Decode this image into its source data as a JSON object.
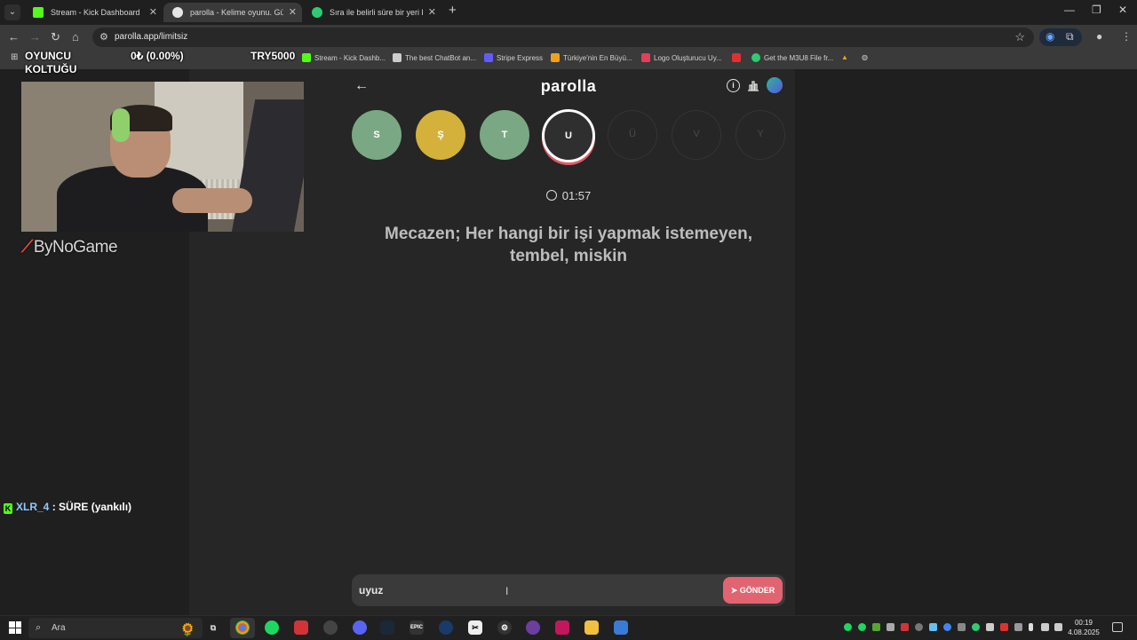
{
  "browser": {
    "tabs": [
      {
        "title": "Stream - Kick Dashboard",
        "favicon_color": "#53fc18"
      },
      {
        "title": "parolla - Kelime oyunu. Günlük",
        "favicon_color": "#e6e6e6"
      },
      {
        "title": "Sıra ile belirli süre bir yeri bekle",
        "favicon_color": "#2ecc71"
      }
    ],
    "url": "parolla.app/limitsiz",
    "bookmarks": [
      {
        "label": "Stream - Kick Dashb...",
        "color": "#53fc18"
      },
      {
        "label": "The best ChatBot an...",
        "color": "#cccccc"
      },
      {
        "label": "Stripe Express",
        "color": "#635bff"
      },
      {
        "label": "Türkiye'nin En Büyü...",
        "color": "#f0a020"
      },
      {
        "label": "Logo Oluşturucu Uy...",
        "color": "#e0405a"
      },
      {
        "label": "",
        "color": "#e03030"
      },
      {
        "label": "Get the M3U8 File fr...",
        "color": "#2ecc71"
      }
    ]
  },
  "overlay": {
    "title_line1": "OYUNCU",
    "title_line2": "KOLTUĞU",
    "progress": "0₺ (0.00%)",
    "goal": "TRY5000",
    "sponsor": "ByNoGame"
  },
  "chat": {
    "username": "XLR_4",
    "message": " : SÜRE (yankılı)"
  },
  "game": {
    "title": "parolla",
    "letters": [
      {
        "char": "S",
        "state": "green"
      },
      {
        "char": "Ş",
        "state": "yellow"
      },
      {
        "char": "T",
        "state": "green"
      },
      {
        "char": "U",
        "state": "current"
      },
      {
        "char": "Ü",
        "state": "pending"
      },
      {
        "char": "V",
        "state": "pending"
      },
      {
        "char": "Y",
        "state": "pending"
      }
    ],
    "timer": "01:57",
    "question": "Mecazen; Her hangi bir işi yapmak istemeyen, tembel, miskin",
    "answer_value": "uyuz",
    "send_label": "GÖNDER"
  },
  "taskbar": {
    "search_label": "Ara",
    "time": "00:19",
    "date": "4.08.2025"
  }
}
